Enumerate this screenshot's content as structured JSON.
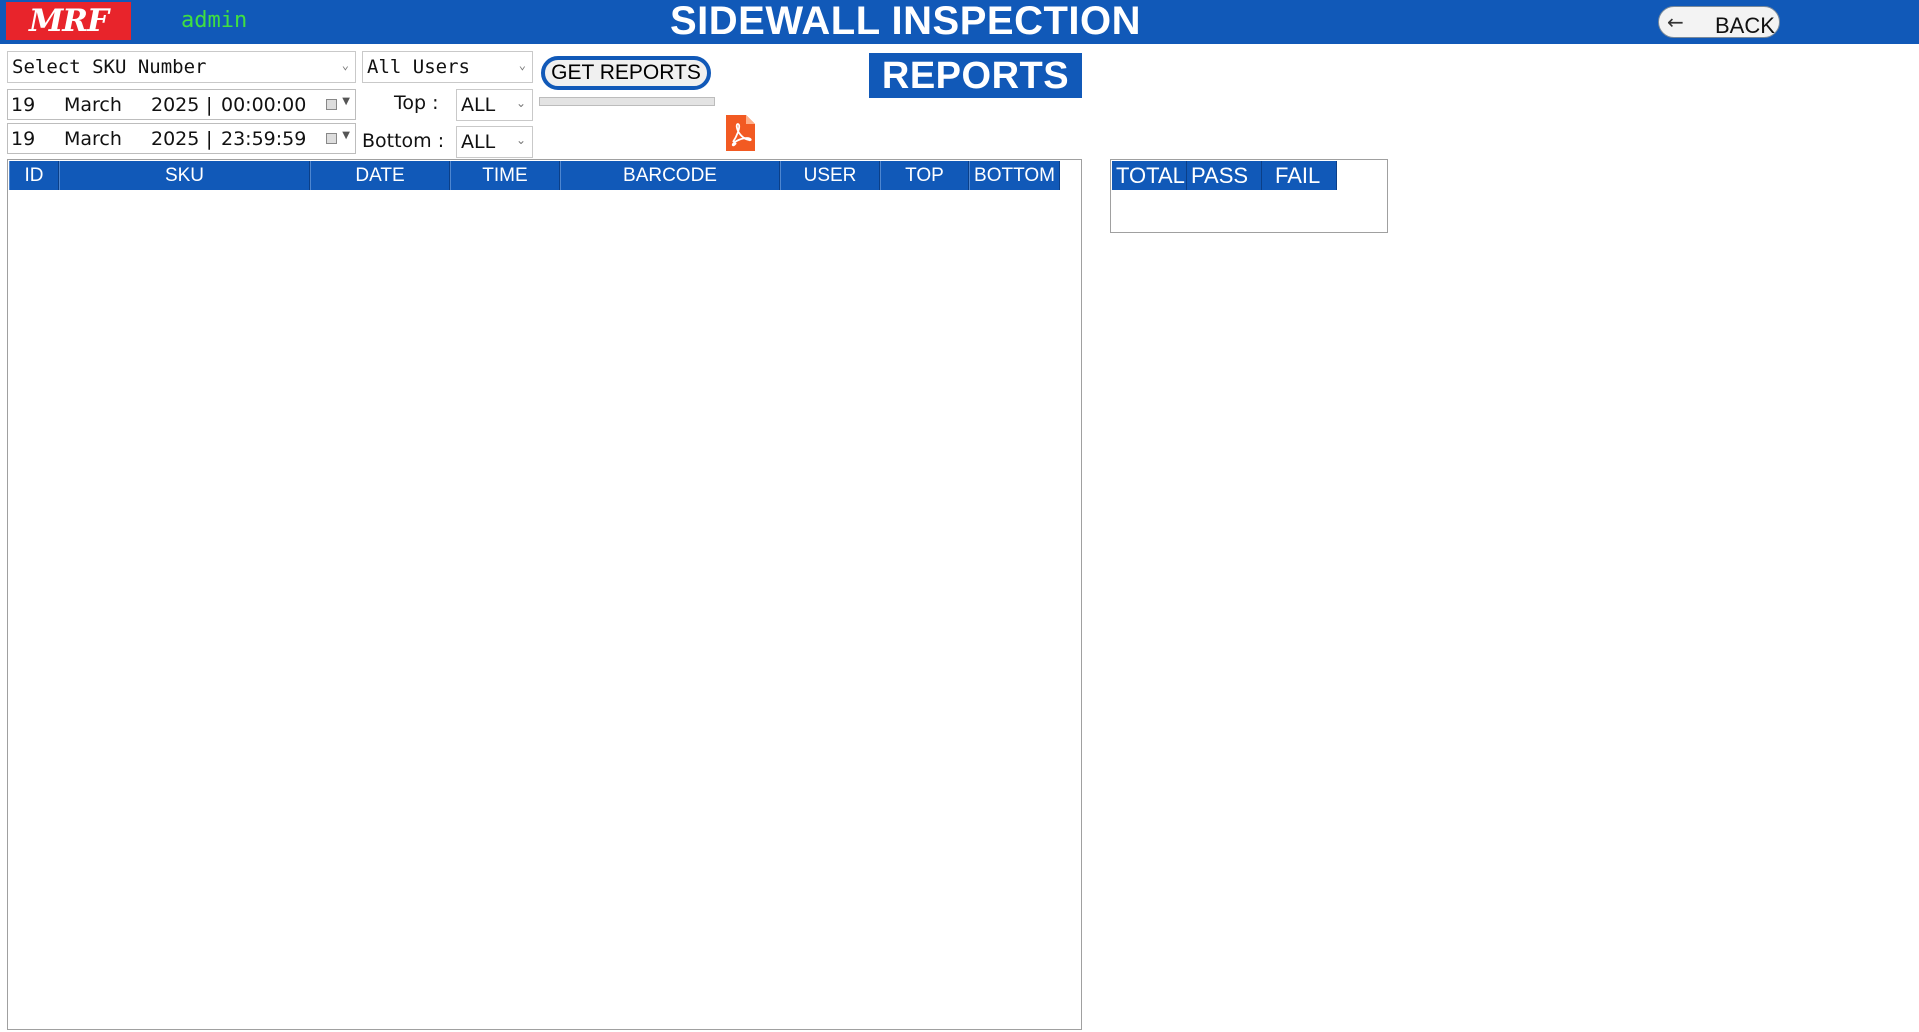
{
  "header": {
    "logo_text": "MRF",
    "user": "admin",
    "title": "SIDEWALL INSPECTION",
    "back_label": "BACK",
    "colors": {
      "bar": "#1159b8",
      "logo_bg": "#e8242b",
      "user_text": "#40e040"
    }
  },
  "filters": {
    "sku": {
      "value": "Select SKU Number"
    },
    "users": {
      "value": "All Users"
    },
    "start": {
      "day": "19",
      "month": "March",
      "year": "2025",
      "sep": "|",
      "time": "00:00:00"
    },
    "end": {
      "day": "19",
      "month": "March",
      "year": "2025",
      "sep": "|",
      "time": "23:59:59"
    },
    "top_label": "Top :",
    "top_value": "ALL",
    "bottom_label": "Bottom :",
    "bottom_value": "ALL"
  },
  "actions": {
    "get_reports_label": "GET REPORTS",
    "progress": 0,
    "export_icon": "pdf-icon"
  },
  "section_title": "REPORTS",
  "report_table": {
    "columns": [
      "ID",
      "SKU",
      "DATE",
      "TIME",
      "BARCODE",
      "USER",
      "TOP",
      "BOTTOM"
    ],
    "rows": []
  },
  "summary_table": {
    "columns": [
      "TOTAL",
      "PASS",
      "FAIL"
    ],
    "rows": []
  }
}
